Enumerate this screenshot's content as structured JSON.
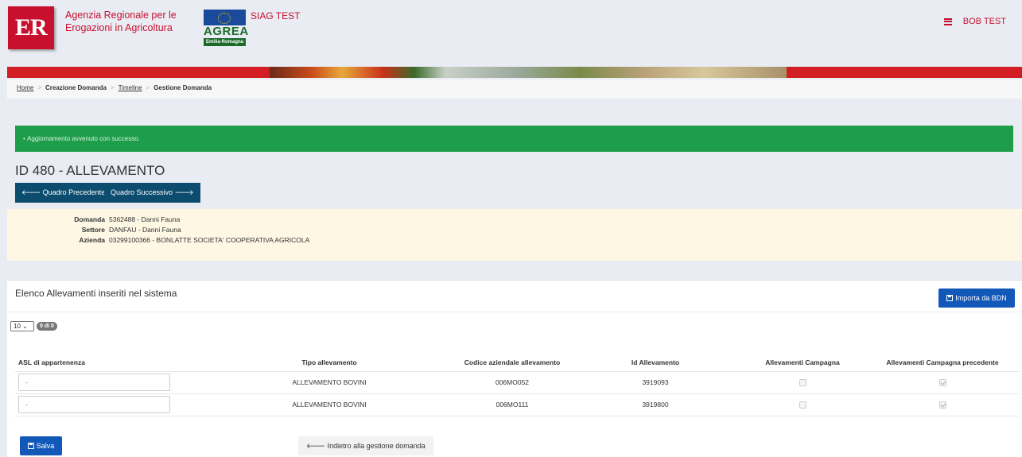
{
  "header": {
    "agency_line1": "Agenzia Regionale per le",
    "agency_line2": "Erogazioni in Agricoltura",
    "er_logo_text": "ER",
    "agrea_word": "AGREA",
    "agrea_sub": "Emilia-Romagna",
    "env_label": "SIAG TEST",
    "user_name": "BOB TEST",
    "menu_icon": "hamburger-icon",
    "accent_color": "#c8102e"
  },
  "breadcrumb": {
    "items": [
      {
        "label": "Home",
        "link": true
      },
      {
        "label": "Creazione Domanda",
        "link": false
      },
      {
        "label": "Timeline",
        "link": true
      },
      {
        "label": "Gestione Domanda",
        "link": false
      }
    ],
    "separator": ">"
  },
  "alert": {
    "message": "Aggiornamento avvenuto con successo.",
    "color": "#1e9e4a"
  },
  "page": {
    "title": "ID 480 - ALLEVAMENTO",
    "prev_button": "Quadro Precedente",
    "next_button": "Quadro Successivo"
  },
  "info": {
    "rows": [
      {
        "label": "Domanda",
        "value": "5362488 - Danni Fauna"
      },
      {
        "label": "Settore",
        "value": "DANFAU - Danni Fauna"
      },
      {
        "label": "Azienda",
        "value": "03299100366 - BONLATTE SOCIETA' COOPERATIVA AGRICOLA"
      }
    ]
  },
  "panel": {
    "title": "Elenco Allevamenti inseriti nel sistema",
    "import_button": "Importa da BDN",
    "page_size": "10",
    "count_badge": "0 di 0",
    "columns": [
      "ASL di appartenenza",
      "Tipo allevamento",
      "Codice aziendale allevamento",
      "Id Allevamento",
      "Allevamenti Campagna",
      "Allevamenti Campagna precedente"
    ],
    "rows": [
      {
        "asl": "-",
        "tipo": "ALLEVAMENTO BOVINI",
        "codice": "006MO052",
        "id": "3919093",
        "campagna": false,
        "precedente": true
      },
      {
        "asl": "-",
        "tipo": "ALLEVAMENTO BOVINI",
        "codice": "006MO111",
        "id": "3919800",
        "campagna": false,
        "precedente": true
      }
    ],
    "save_button": "Salva",
    "back_button": "Indietro alla gestione domanda",
    "button_color": "#1258b8"
  }
}
